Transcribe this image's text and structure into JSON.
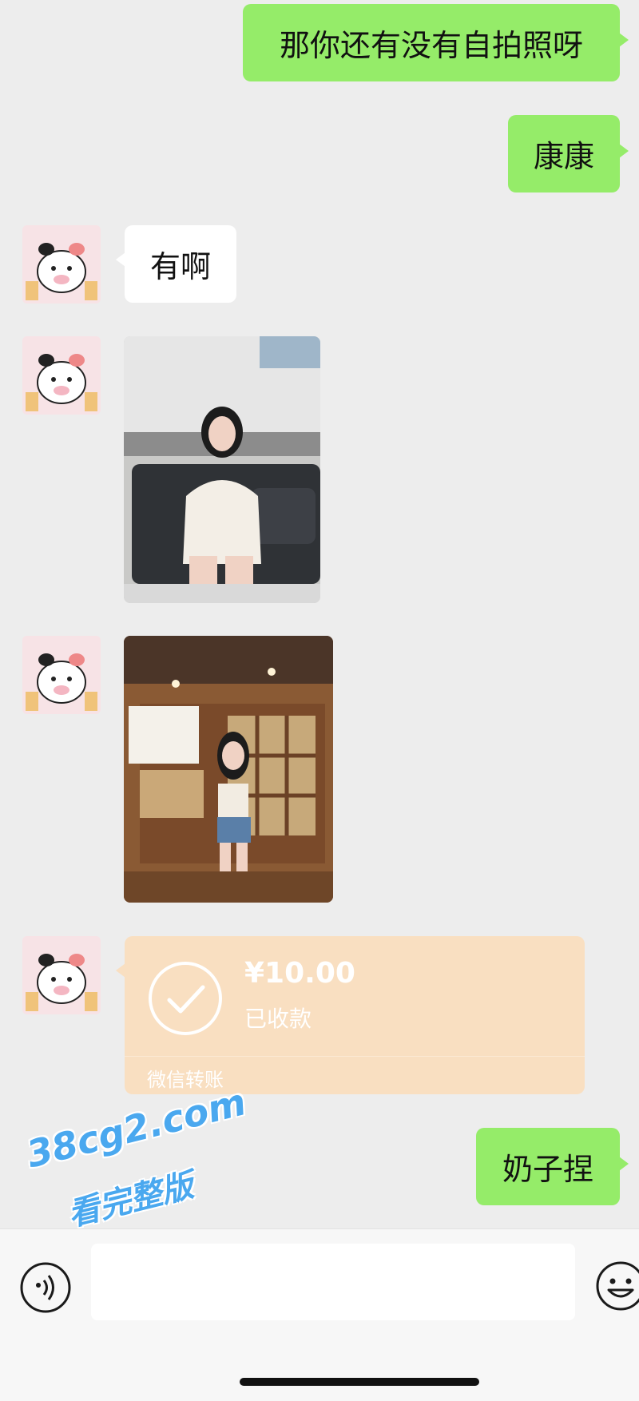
{
  "messages": {
    "m1": "那你还有没有自拍照呀",
    "m2": "康康",
    "m3": "有啊",
    "m4": "奶子捏"
  },
  "transfer": {
    "amount": "¥10.00",
    "status": "已收款",
    "label": "微信转账"
  },
  "watermark": {
    "site": "38cg2.com",
    "tagline": "看完整版"
  },
  "colors": {
    "outgoing_bubble": "#95ec69",
    "incoming_bubble": "#ffffff",
    "transfer_card": "#f9dfc1",
    "background": "#ededed",
    "watermark": "#4aa8ef"
  },
  "icons": {
    "voice": "voice-input-icon",
    "emoji": "emoji-icon"
  }
}
